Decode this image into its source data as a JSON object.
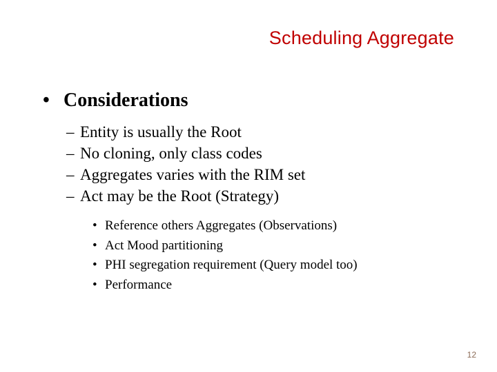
{
  "title": "Scheduling Aggregate",
  "heading": "Considerations",
  "sub": [
    "Entity is usually the Root",
    "No cloning, only class codes",
    "Aggregates varies with the RIM set",
    "Act may be the Root (Strategy)"
  ],
  "subsub": [
    "Reference others Aggregates (Observations)",
    "Act Mood partitioning",
    "PHI segregation requirement (Query model too)",
    "Performance"
  ],
  "page_number": "12"
}
